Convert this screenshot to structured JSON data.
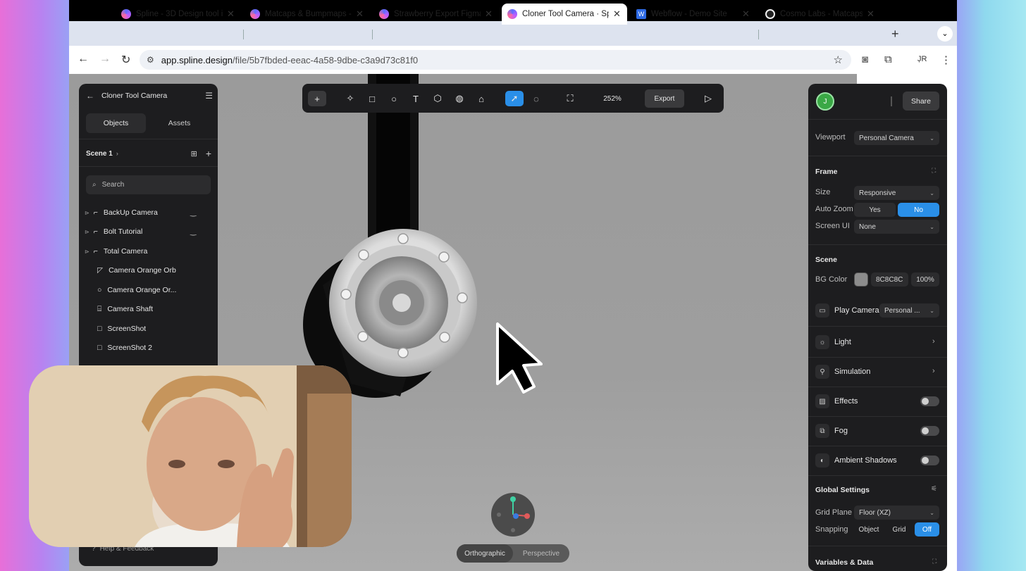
{
  "browser": {
    "tabs": [
      {
        "title": "Spline - 3D Design tool in",
        "active": false,
        "favicon": "spline-icon"
      },
      {
        "title": "Matcaps & Bumpmaps - S",
        "active": false,
        "favicon": "spline-icon"
      },
      {
        "title": "Strawberry Export Figma",
        "active": false,
        "favicon": "spline-icon"
      },
      {
        "title": "Cloner Tool Camera · Spl",
        "active": true,
        "favicon": "spline-icon"
      },
      {
        "title": "Webflow - Demo Site",
        "active": false,
        "favicon": "webflow-icon"
      },
      {
        "title": "Cosmo Labs - Matcaps -",
        "active": false,
        "favicon": "cosmo-icon"
      }
    ],
    "url_host": "app.spline.design",
    "url_path": "/file/5b7fbded-eeac-4a58-9dbe-c3a9d73c81f0",
    "profile_initial": "J̣R",
    "new_tab": "+",
    "close": "✕"
  },
  "toolbar": {
    "zoom": "252%",
    "export_label": "Export"
  },
  "left_panel": {
    "file_title": "Cloner Tool Camera",
    "tab_objects": "Objects",
    "tab_assets": "Assets",
    "scene_label": "Scene 1",
    "search_placeholder": "Search",
    "items": [
      {
        "label": "BackUp Camera",
        "icon": "camera-group-icon"
      },
      {
        "label": "Bolt Tutorial",
        "icon": "camera-group-icon"
      },
      {
        "label": "Total Camera",
        "icon": "camera-group-icon"
      },
      {
        "label": "Camera Orange Orb",
        "icon": "plane-icon"
      },
      {
        "label": "Camera Orange Or...",
        "icon": "sphere-icon"
      },
      {
        "label": "Camera Shaft",
        "icon": "cylinder-icon"
      },
      {
        "label": "ScreenShot",
        "icon": "rectangle-icon"
      },
      {
        "label": "ScreenShot 2",
        "icon": "rectangle-icon"
      }
    ],
    "help_label": "Help & Feedback"
  },
  "right_panel": {
    "avatar_initial": "J",
    "share_label": "Share",
    "viewport_label": "Viewport",
    "viewport_value": "Personal Camera",
    "frame_heading": "Frame",
    "size_label": "Size",
    "size_value": "Responsive",
    "autozoom_label": "Auto Zoom",
    "autozoom_yes": "Yes",
    "autozoom_no": "No",
    "screenui_label": "Screen UI",
    "screenui_value": "None",
    "scene_heading": "Scene",
    "bgcolor_label": "BG Color",
    "bgcolor_hex": "8C8C8C",
    "bgcolor_opacity": "100%",
    "bgcolor_swatch": "#8c8c8c",
    "playcamera_label": "Play Camera",
    "playcamera_value": "Personal ...",
    "light_label": "Light",
    "simulation_label": "Simulation",
    "effects_label": "Effects",
    "fog_label": "Fog",
    "ambient_label": "Ambient Shadows",
    "global_heading": "Global Settings",
    "gridplane_label": "Grid Plane",
    "gridplane_value": "Floor (XZ)",
    "snapping_label": "Snapping",
    "snap_object": "Object",
    "snap_grid": "Grid",
    "snap_off": "Off",
    "variables_heading": "Variables & Data"
  },
  "viewport": {
    "orthographic": "Orthographic",
    "perspective": "Perspective"
  },
  "colors": {
    "accent": "#2a8fe8",
    "panel": "#1d1d1f",
    "avatar": "#3aa845"
  }
}
